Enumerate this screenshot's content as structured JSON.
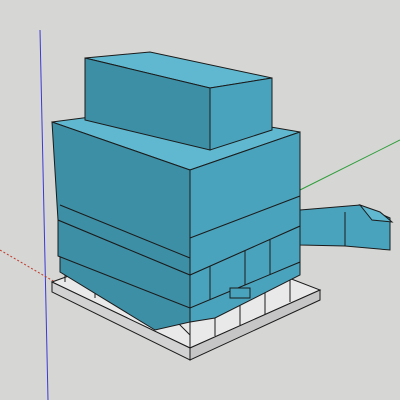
{
  "viewport": {
    "background": "#d6d6d4",
    "axes": {
      "red_color": "#c0392b",
      "green_color": "#2e9e3a",
      "blue_color": "#3b3bd1"
    }
  },
  "model": {
    "kind": "industrial baghouse dust collector",
    "body_color": "#4aa3bd",
    "body_top_color": "#5fb8cf",
    "body_shade_color": "#3d8fa6",
    "base_color": "#e9e9e9",
    "edge_color": "#1b1b1b",
    "icons": [
      "box-3d-icon"
    ]
  }
}
